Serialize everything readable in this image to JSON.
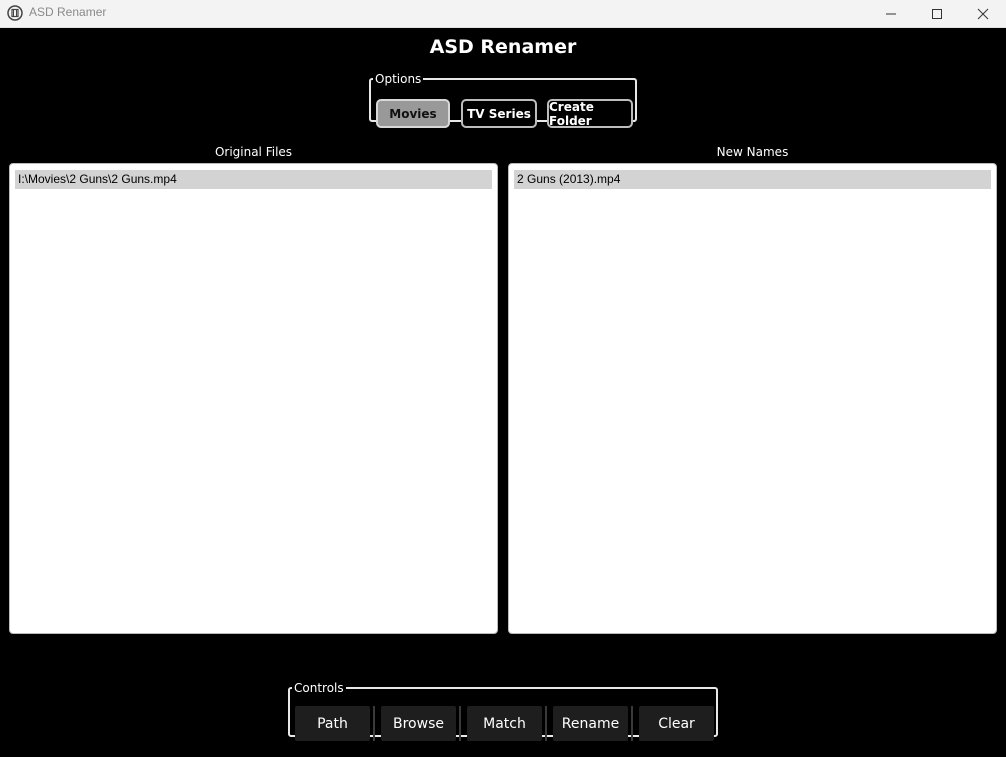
{
  "window": {
    "title": "ASD Renamer",
    "icons": [
      "film-icon",
      "minimize-icon",
      "maximize-icon",
      "close-icon"
    ]
  },
  "app": {
    "heading": "ASD Renamer"
  },
  "options": {
    "legend": "Options",
    "buttons": [
      {
        "label": "Movies",
        "active": true
      },
      {
        "label": "TV Series",
        "active": false
      },
      {
        "label": "Create Folder",
        "active": false
      }
    ]
  },
  "original": {
    "label": "Original Files",
    "items": [
      "I:\\Movies\\2 Guns\\2 Guns.mp4"
    ]
  },
  "newnames": {
    "label": "New Names",
    "items": [
      "2 Guns (2013).mp4"
    ]
  },
  "controls": {
    "legend": "Controls",
    "buttons": [
      "Path",
      "Browse",
      "Match",
      "Rename",
      "Clear"
    ]
  },
  "colors": {
    "background": "#000000",
    "active_option": "#999999",
    "control_button": "#1e1e1e",
    "selected_row": "#d3d3d3"
  }
}
